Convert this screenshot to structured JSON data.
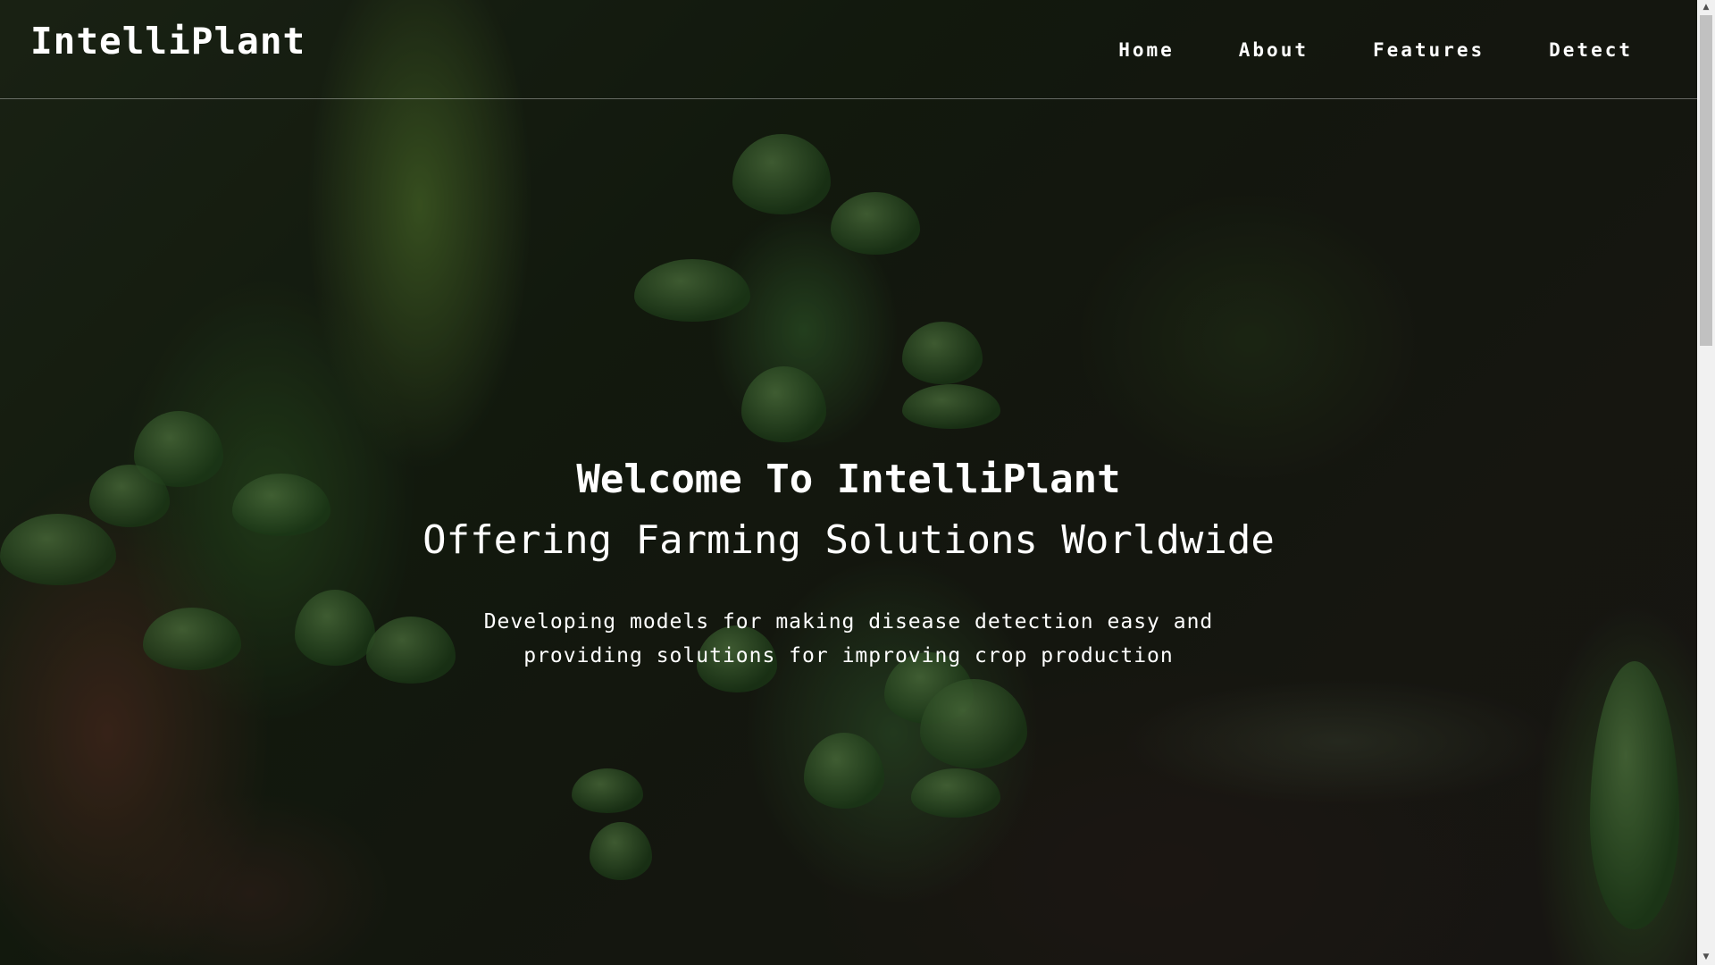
{
  "header": {
    "logo": "IntelliPlant",
    "nav": [
      {
        "label": "Home"
      },
      {
        "label": "About"
      },
      {
        "label": "Features"
      },
      {
        "label": "Detect"
      }
    ]
  },
  "hero": {
    "title": "Welcome To IntelliPlant",
    "subtitle": "Offering Farming Solutions Worldwide",
    "description": "Developing models for making disease detection easy and providing solutions for improving crop production",
    "background": "blurred macro photo of small green plant sprouts with dry leaf",
    "overlay_color": "#000000"
  },
  "scrollbar": {
    "up_icon": "scroll-up-arrow-icon",
    "down_icon": "scroll-down-arrow-icon",
    "up_glyph": "▲",
    "down_glyph": "▼"
  }
}
